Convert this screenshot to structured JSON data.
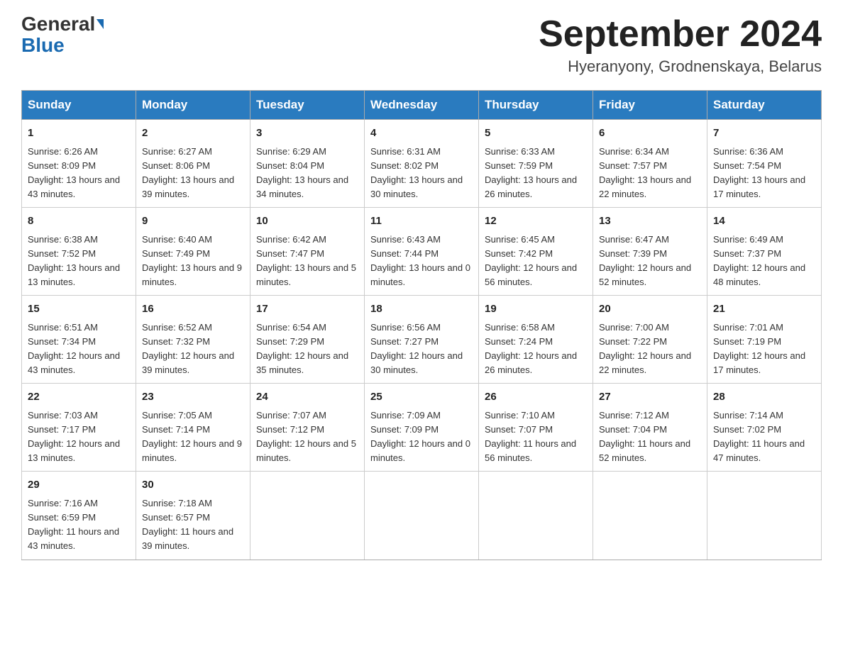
{
  "header": {
    "logo_general": "General",
    "logo_blue": "Blue",
    "month_year": "September 2024",
    "location": "Hyeranyony, Grodnenskaya, Belarus"
  },
  "days_of_week": [
    "Sunday",
    "Monday",
    "Tuesday",
    "Wednesday",
    "Thursday",
    "Friday",
    "Saturday"
  ],
  "weeks": [
    [
      {
        "day": "1",
        "sunrise": "6:26 AM",
        "sunset": "8:09 PM",
        "daylight": "13 hours and 43 minutes."
      },
      {
        "day": "2",
        "sunrise": "6:27 AM",
        "sunset": "8:06 PM",
        "daylight": "13 hours and 39 minutes."
      },
      {
        "day": "3",
        "sunrise": "6:29 AM",
        "sunset": "8:04 PM",
        "daylight": "13 hours and 34 minutes."
      },
      {
        "day": "4",
        "sunrise": "6:31 AM",
        "sunset": "8:02 PM",
        "daylight": "13 hours and 30 minutes."
      },
      {
        "day": "5",
        "sunrise": "6:33 AM",
        "sunset": "7:59 PM",
        "daylight": "13 hours and 26 minutes."
      },
      {
        "day": "6",
        "sunrise": "6:34 AM",
        "sunset": "7:57 PM",
        "daylight": "13 hours and 22 minutes."
      },
      {
        "day": "7",
        "sunrise": "6:36 AM",
        "sunset": "7:54 PM",
        "daylight": "13 hours and 17 minutes."
      }
    ],
    [
      {
        "day": "8",
        "sunrise": "6:38 AM",
        "sunset": "7:52 PM",
        "daylight": "13 hours and 13 minutes."
      },
      {
        "day": "9",
        "sunrise": "6:40 AM",
        "sunset": "7:49 PM",
        "daylight": "13 hours and 9 minutes."
      },
      {
        "day": "10",
        "sunrise": "6:42 AM",
        "sunset": "7:47 PM",
        "daylight": "13 hours and 5 minutes."
      },
      {
        "day": "11",
        "sunrise": "6:43 AM",
        "sunset": "7:44 PM",
        "daylight": "13 hours and 0 minutes."
      },
      {
        "day": "12",
        "sunrise": "6:45 AM",
        "sunset": "7:42 PM",
        "daylight": "12 hours and 56 minutes."
      },
      {
        "day": "13",
        "sunrise": "6:47 AM",
        "sunset": "7:39 PM",
        "daylight": "12 hours and 52 minutes."
      },
      {
        "day": "14",
        "sunrise": "6:49 AM",
        "sunset": "7:37 PM",
        "daylight": "12 hours and 48 minutes."
      }
    ],
    [
      {
        "day": "15",
        "sunrise": "6:51 AM",
        "sunset": "7:34 PM",
        "daylight": "12 hours and 43 minutes."
      },
      {
        "day": "16",
        "sunrise": "6:52 AM",
        "sunset": "7:32 PM",
        "daylight": "12 hours and 39 minutes."
      },
      {
        "day": "17",
        "sunrise": "6:54 AM",
        "sunset": "7:29 PM",
        "daylight": "12 hours and 35 minutes."
      },
      {
        "day": "18",
        "sunrise": "6:56 AM",
        "sunset": "7:27 PM",
        "daylight": "12 hours and 30 minutes."
      },
      {
        "day": "19",
        "sunrise": "6:58 AM",
        "sunset": "7:24 PM",
        "daylight": "12 hours and 26 minutes."
      },
      {
        "day": "20",
        "sunrise": "7:00 AM",
        "sunset": "7:22 PM",
        "daylight": "12 hours and 22 minutes."
      },
      {
        "day": "21",
        "sunrise": "7:01 AM",
        "sunset": "7:19 PM",
        "daylight": "12 hours and 17 minutes."
      }
    ],
    [
      {
        "day": "22",
        "sunrise": "7:03 AM",
        "sunset": "7:17 PM",
        "daylight": "12 hours and 13 minutes."
      },
      {
        "day": "23",
        "sunrise": "7:05 AM",
        "sunset": "7:14 PM",
        "daylight": "12 hours and 9 minutes."
      },
      {
        "day": "24",
        "sunrise": "7:07 AM",
        "sunset": "7:12 PM",
        "daylight": "12 hours and 5 minutes."
      },
      {
        "day": "25",
        "sunrise": "7:09 AM",
        "sunset": "7:09 PM",
        "daylight": "12 hours and 0 minutes."
      },
      {
        "day": "26",
        "sunrise": "7:10 AM",
        "sunset": "7:07 PM",
        "daylight": "11 hours and 56 minutes."
      },
      {
        "day": "27",
        "sunrise": "7:12 AM",
        "sunset": "7:04 PM",
        "daylight": "11 hours and 52 minutes."
      },
      {
        "day": "28",
        "sunrise": "7:14 AM",
        "sunset": "7:02 PM",
        "daylight": "11 hours and 47 minutes."
      }
    ],
    [
      {
        "day": "29",
        "sunrise": "7:16 AM",
        "sunset": "6:59 PM",
        "daylight": "11 hours and 43 minutes."
      },
      {
        "day": "30",
        "sunrise": "7:18 AM",
        "sunset": "6:57 PM",
        "daylight": "11 hours and 39 minutes."
      },
      null,
      null,
      null,
      null,
      null
    ]
  ],
  "labels": {
    "sunrise": "Sunrise:",
    "sunset": "Sunset:",
    "daylight": "Daylight:"
  }
}
